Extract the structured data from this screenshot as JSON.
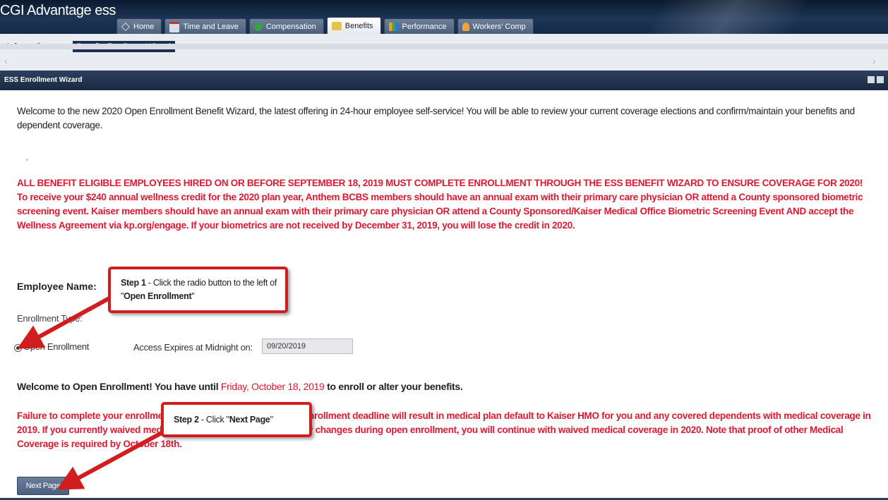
{
  "app": {
    "title": "CGI Advantage ess"
  },
  "tabs": [
    {
      "label": "Home",
      "icon": "home-icon",
      "active": false
    },
    {
      "label": "Time and Leave",
      "icon": "calendar-icon",
      "active": false
    },
    {
      "label": "Compensation",
      "icon": "money-icon",
      "active": false
    },
    {
      "label": "Benefits",
      "icon": "benefits-icon",
      "active": true
    },
    {
      "label": "Performance",
      "icon": "chart-icon",
      "active": false
    },
    {
      "label": "Workers' Comp",
      "icon": "person-icon",
      "active": false
    }
  ],
  "subtabs": {
    "information": "Information",
    "wizard": "Benefits Enrollment Wizard"
  },
  "nav": {
    "left": "‹",
    "right": "›"
  },
  "panel": {
    "title": "ESS Enrollment Wizard"
  },
  "intro": "Welcome to the new 2020 Open Enrollment Benefit Wizard, the latest offering in 24-hour employee self-service! You will be able to review your current coverage elections and confirm/maintain your benefits and dependent coverage.",
  "notice": "ALL BENEFIT ELIGIBLE EMPLOYEES HIRED ON OR BEFORE SEPTEMBER 18, 2019 MUST COMPLETE ENROLLMENT THROUGH THE ESS BENEFIT WIZARD TO ENSURE COVERAGE FOR 2020! To receive your $240 annual wellness credit for the 2020 plan year, Anthem BCBS members should have an annual exam with their primary care physician OR attend a County sponsored biometric screening event. Kaiser members should have an annual exam with their primary care physician OR attend a County Sponsored/Kaiser Medical Office Biometric Screening Event AND accept the Wellness Agreement via kp.org/engage. If your biometrics are not received by December 31, 2019, you will lose the credit in 2020.",
  "employee": {
    "label": "Employee Name:"
  },
  "enrollment": {
    "type_label": "Enrollment Type:",
    "option_label": "Open Enrollment",
    "access_label": "Access Expires at Midnight on:",
    "expires": "09/20/2019"
  },
  "welcome": {
    "before": "Welcome to Open Enrollment! You have until ",
    "deadline": "Friday, October 18, 2019",
    "after": " to enroll or alter your benefits."
  },
  "failure": "Failure to complete your enrollment before the October 18th open enrollment deadline will result in medical plan default to Kaiser HMO for you and any covered dependents with medical coverage in 2019. If you currently waived medical coverage and do not make any changes during open enrollment, you will continue with waived medical coverage in 2020. Note that proof of other Medical Coverage is required by October 18th.",
  "next_button": "Next Page",
  "callouts": {
    "step1": {
      "step": "Step 1",
      "text_a": " - Click the radio button to the left of \"",
      "bold": "Open Enrollment",
      "text_b": "\""
    },
    "step2": {
      "step": "Step 2",
      "text_a": " - Click \"",
      "bold": "Next Page",
      "text_b": "\""
    }
  },
  "colors": {
    "alert_red": "#e3172f",
    "callout_border": "#d11d1d",
    "header_navy": "#1a2a44"
  }
}
